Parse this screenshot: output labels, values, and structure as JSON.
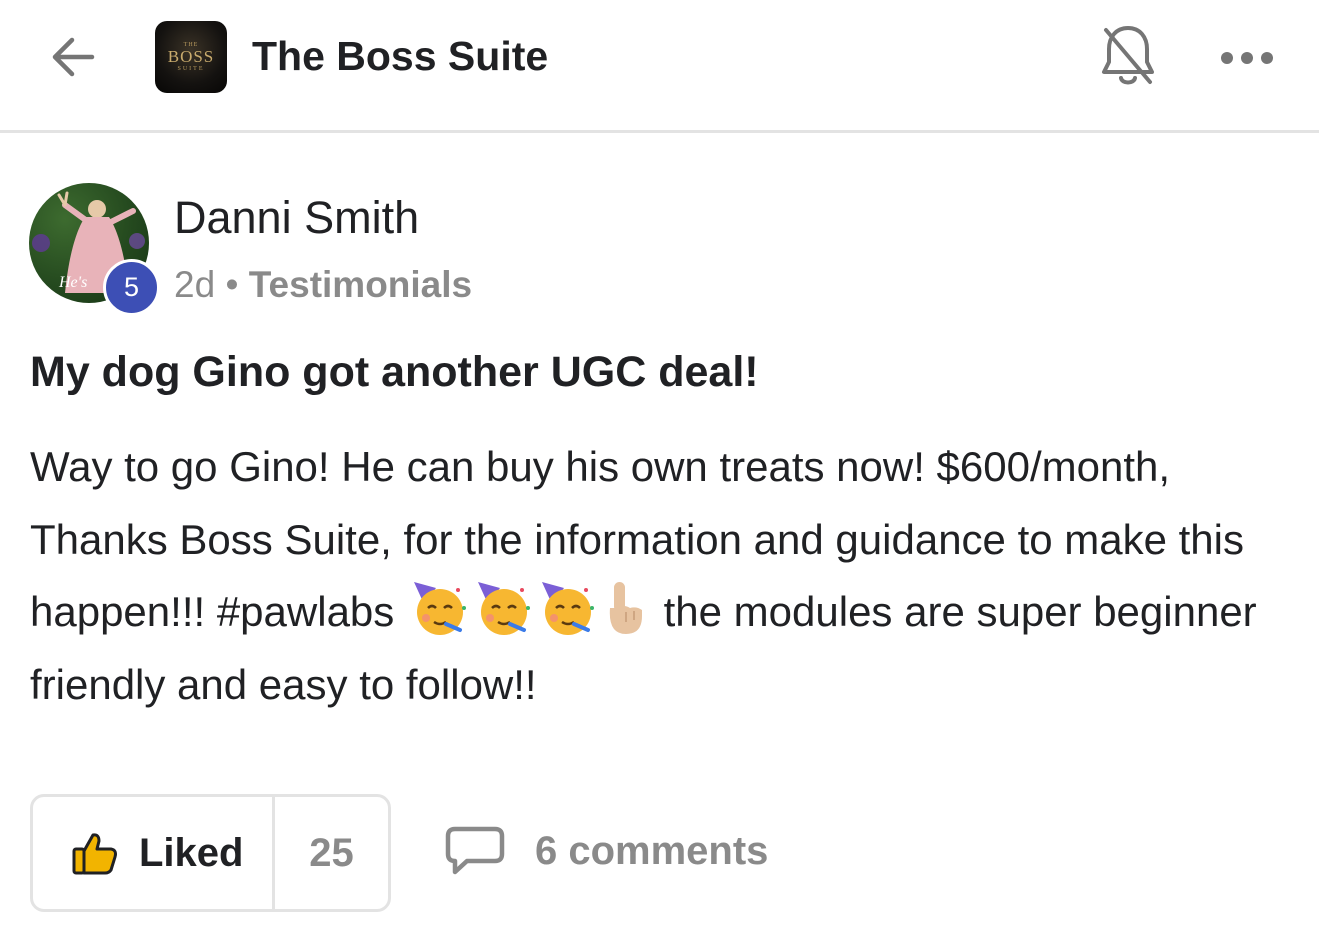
{
  "header": {
    "title": "The Boss Suite",
    "logo": {
      "top": "THE",
      "main": "BOSS",
      "sub": "SUITE"
    },
    "back_icon": "arrow-left-icon",
    "bell_icon": "bell-off-icon",
    "more_icon": "more-horizontal-icon"
  },
  "post": {
    "author": {
      "name": "Danni Smith",
      "level": "5"
    },
    "time": "2d",
    "separator": "•",
    "category": "Testimonials",
    "title": "My dog Gino got another UGC deal!",
    "body_before_emoji": "Way to go Gino! He can buy his own treats now! $600/month, Thanks Boss Suite, for the information and guidance to make this happen!!! #pawlabs",
    "emojis": [
      "partying-face-icon",
      "partying-face-icon",
      "partying-face-icon",
      "pointing-up-icon"
    ],
    "body_after_emoji": "the modules are super beginner friendly and easy to follow!!"
  },
  "actions": {
    "like_label": "Liked",
    "like_count": "25",
    "comments_label": "6 comments"
  },
  "colors": {
    "level_badge": "#3d4fb5",
    "like_icon": "#f2b400",
    "muted": "#8a8a8a"
  }
}
